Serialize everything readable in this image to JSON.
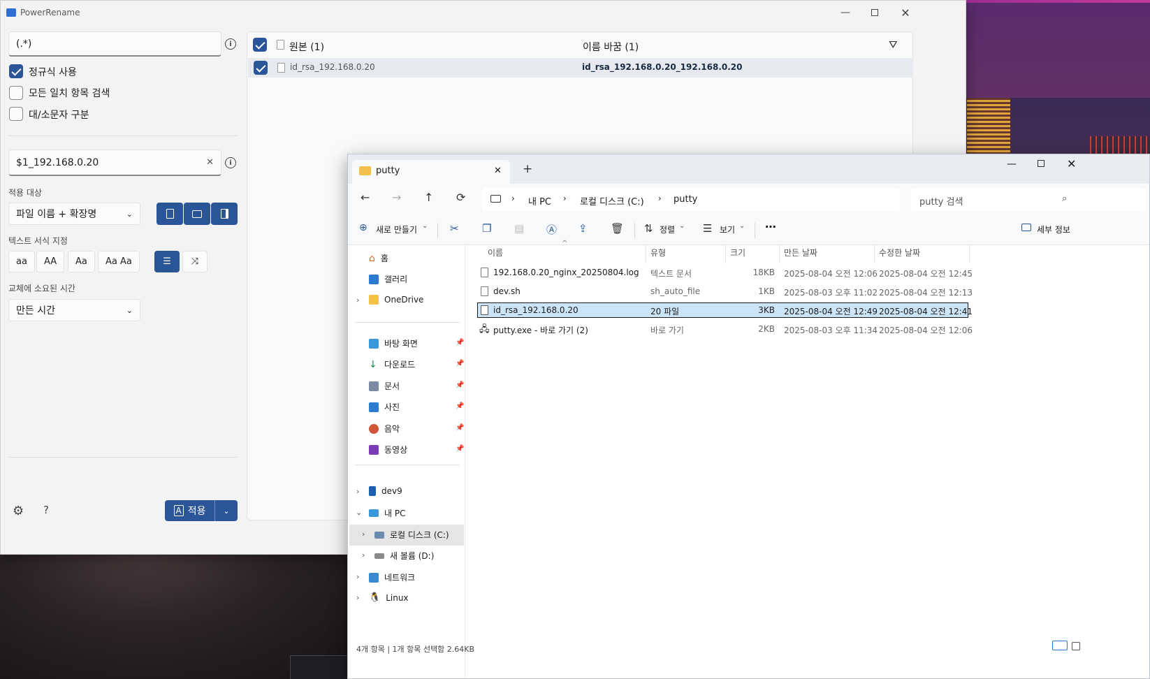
{
  "powerrename": {
    "title": "PowerRename",
    "search_value": "(.*)",
    "options": [
      {
        "label": "정규식 사용",
        "checked": true
      },
      {
        "label": "모든 일치 항목 검색",
        "checked": false
      },
      {
        "label": "대/소문자 구분",
        "checked": false
      }
    ],
    "replace_value": "$1_192.168.0.20",
    "apply_to_label": "적용 대상",
    "apply_to_value": "파일 이름 + 확장명",
    "text_format_label": "텍스트 서식 지정",
    "format_buttons": [
      "aa",
      "AA",
      "Aa",
      "Aa Aa"
    ],
    "time_label": "교체에 소요된 시간",
    "time_value": "만든 시간",
    "apply_button": "적용",
    "help": "?",
    "list": {
      "original_header": "원본 (1)",
      "renamed_header": "이름 바꿈 (1)",
      "rows": [
        {
          "original": "id_rsa_192.168.0.20",
          "renamed": "id_rsa_192.168.0.20_192.168.0.20"
        }
      ]
    }
  },
  "explorer": {
    "tab_title": "putty",
    "breadcrumb": [
      "내 PC",
      "로컬 디스크 (C:)",
      "putty"
    ],
    "search_placeholder": "putty 검색",
    "commands": {
      "new": "새로 만들기",
      "sort": "정렬",
      "view": "보기",
      "details": "세부 정보"
    },
    "tree": {
      "home": "홈",
      "gallery": "갤러리",
      "onedrive": "OneDrive",
      "pinned": [
        "바탕 화면",
        "다운로드",
        "문서",
        "사진",
        "음악",
        "동영상"
      ],
      "dev9": "dev9",
      "mypc": "내 PC",
      "drive_c": "로컬 디스크 (C:)",
      "drive_d": "새 볼륨 (D:)",
      "network": "네트워크",
      "linux": "Linux"
    },
    "columns": [
      "이름",
      "유형",
      "크기",
      "만든 날짜",
      "수정한 날짜"
    ],
    "files": [
      {
        "name": "192.168.0.20_nginx_20250804.log",
        "type": "텍스트 문서",
        "size": "18KB",
        "created": "2025-08-04 오전 12:06",
        "modified": "2025-08-04 오전 12:45"
      },
      {
        "name": "dev.sh",
        "type": "sh_auto_file",
        "size": "1KB",
        "created": "2025-08-03 오후 11:02",
        "modified": "2025-08-04 오전 12:13"
      },
      {
        "name": "id_rsa_192.168.0.20",
        "type": "20 파일",
        "size": "3KB",
        "created": "2025-08-04 오전 12:49",
        "modified": "2025-08-04 오전 12:41"
      },
      {
        "name": "putty.exe - 바로 가기 (2)",
        "type": "바로 가기",
        "size": "2KB",
        "created": "2025-08-03 오후 11:34",
        "modified": "2025-08-04 오전 12:06"
      }
    ],
    "status": "4개 항목 | 1개 항목 선택함 2.64KB"
  }
}
